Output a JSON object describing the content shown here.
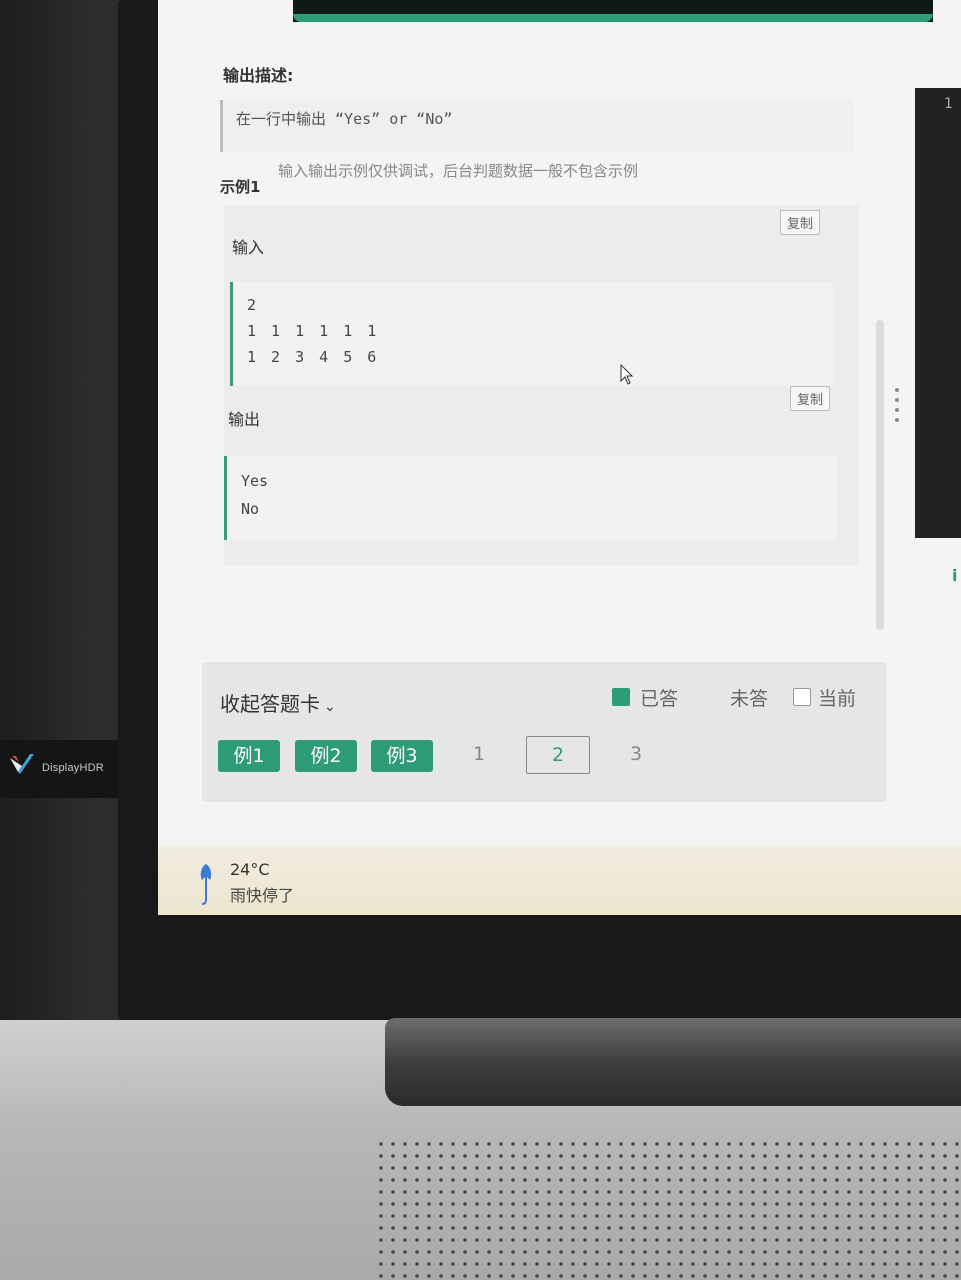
{
  "monitor_badge": "DisplayHDR",
  "problem": {
    "output_desc_title": "输出描述:",
    "output_desc_text": "在一行中输出 “Yes” or “No”"
  },
  "example": {
    "title": "示例1",
    "note": "输入输出示例仅供调试，后台判题数据一般不包含示例",
    "input_label": "输入",
    "input_lines": [
      "2",
      "1 1 1 1 1 1",
      "1 2 3 4 5 6"
    ],
    "output_label": "输出",
    "output_lines": [
      "Yes",
      "No"
    ],
    "copy_label": "复制"
  },
  "side_panel": {
    "number": "1",
    "partial_text": "i"
  },
  "answer_card": {
    "collapse_label": "收起答题卡",
    "legend_answered": "已答",
    "legend_unanswered": "未答",
    "legend_current": "当前",
    "example_chips": [
      "例1",
      "例2",
      "例3"
    ],
    "questions": [
      "1",
      "2",
      "3"
    ],
    "current_question": "2"
  },
  "weather": {
    "temperature": "24°C",
    "condition": "雨快停了"
  },
  "colors": {
    "accent": "#2e9c78",
    "screen_bg": "#f4f4f4"
  }
}
